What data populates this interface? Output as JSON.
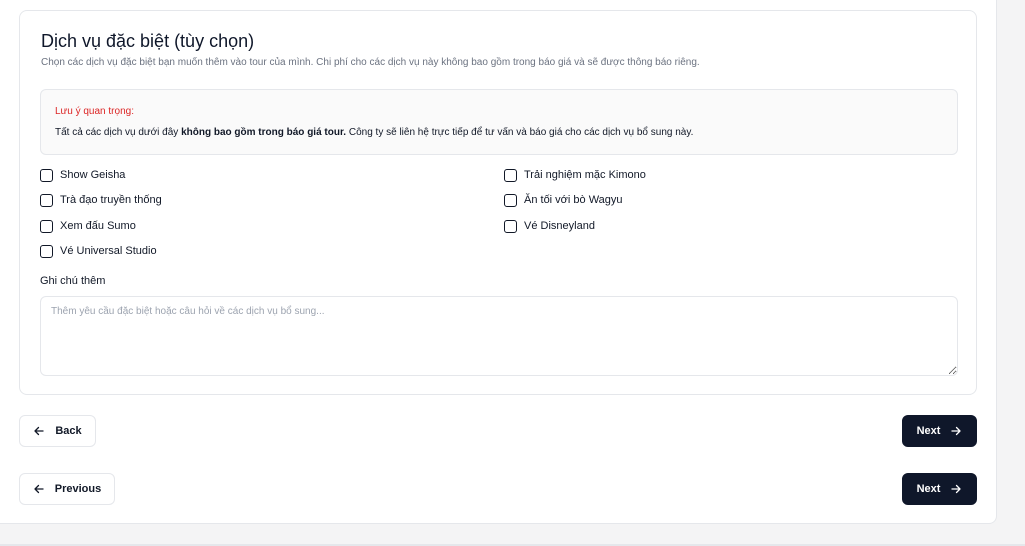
{
  "section": {
    "title": "Dịch vụ đặc biệt (tùy chọn)",
    "description": "Chọn các dịch vụ đặc biệt bạn muốn thêm vào tour của mình. Chi phí cho các dịch vụ này không bao gồm trong báo giá và sẽ được thông báo riêng."
  },
  "notice": {
    "title": "Lưu ý quan trọng:",
    "text_before": "Tất cả các dịch vụ dưới đây ",
    "text_bold": "không bao gồm trong báo giá tour.",
    "text_after": " Công ty sẽ liên hệ trực tiếp để tư vấn và báo giá cho các dịch vụ bổ sung này."
  },
  "options": [
    {
      "label": "Show Geisha",
      "checked": false
    },
    {
      "label": "Trải nghiệm mặc Kimono",
      "checked": false
    },
    {
      "label": "Trà đạo truyền thống",
      "checked": false
    },
    {
      "label": "Ăn tối với bò Wagyu",
      "checked": false
    },
    {
      "label": "Xem đấu Sumo",
      "checked": false
    },
    {
      "label": "Vé Disneyland",
      "checked": false
    },
    {
      "label": "Vé Universal Studio",
      "checked": false
    }
  ],
  "notes": {
    "label": "Ghi chú thêm",
    "placeholder": "Thêm yêu cầu đặc biệt hoặc câu hỏi về các dịch vụ bổ sung...",
    "value": ""
  },
  "nav_inner": {
    "back_label": "Back",
    "next_label": "Next"
  },
  "nav_outer": {
    "previous_label": "Previous",
    "next_label": "Next"
  },
  "icons": {
    "back": "arrow-left-icon",
    "next": "arrow-right-icon"
  },
  "colors": {
    "primary_dark": "#0f172a",
    "warning_red": "#dc2626",
    "border": "#e5e7eb"
  }
}
